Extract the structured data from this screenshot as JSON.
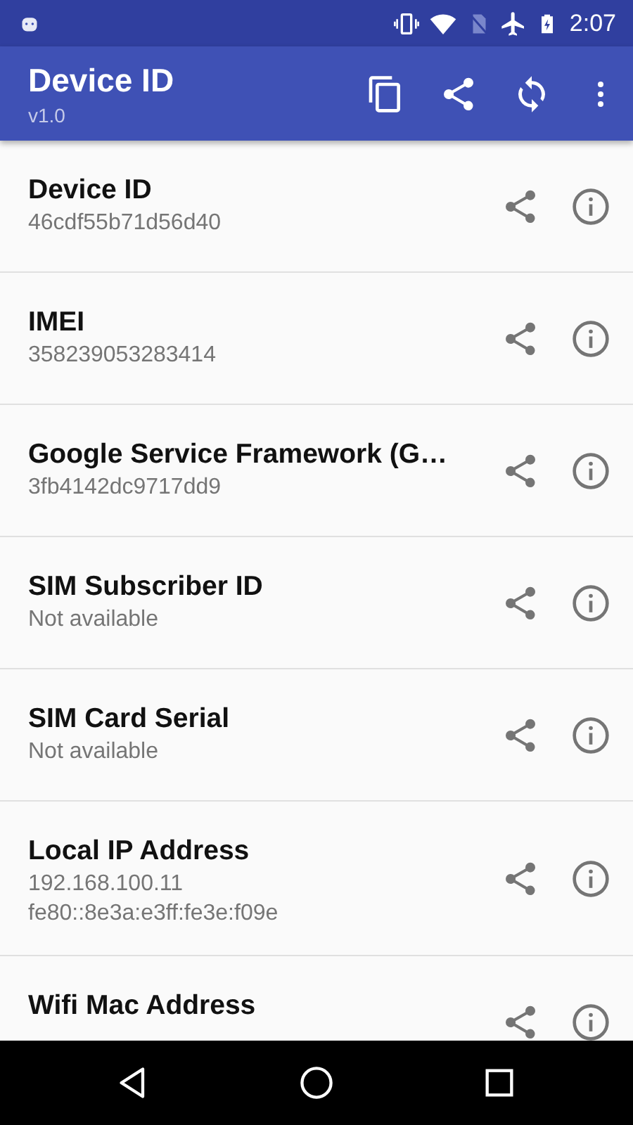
{
  "status_bar": {
    "time": "2:07"
  },
  "app_bar": {
    "title": "Device ID",
    "subtitle": "v1.0"
  },
  "items": [
    {
      "title": "Device ID",
      "values": [
        "46cdf55b71d56d40"
      ]
    },
    {
      "title": "IMEI",
      "values": [
        "358239053283414"
      ]
    },
    {
      "title": "Google Service Framework (G…",
      "values": [
        "3fb4142dc9717dd9"
      ]
    },
    {
      "title": "SIM Subscriber ID",
      "values": [
        "Not available"
      ]
    },
    {
      "title": "SIM Card Serial",
      "values": [
        "Not available"
      ]
    },
    {
      "title": "Local IP Address",
      "values": [
        "192.168.100.11",
        "fe80::8e3a:e3ff:fe3e:f09e"
      ]
    },
    {
      "title": "Wifi Mac Address"
    }
  ]
}
